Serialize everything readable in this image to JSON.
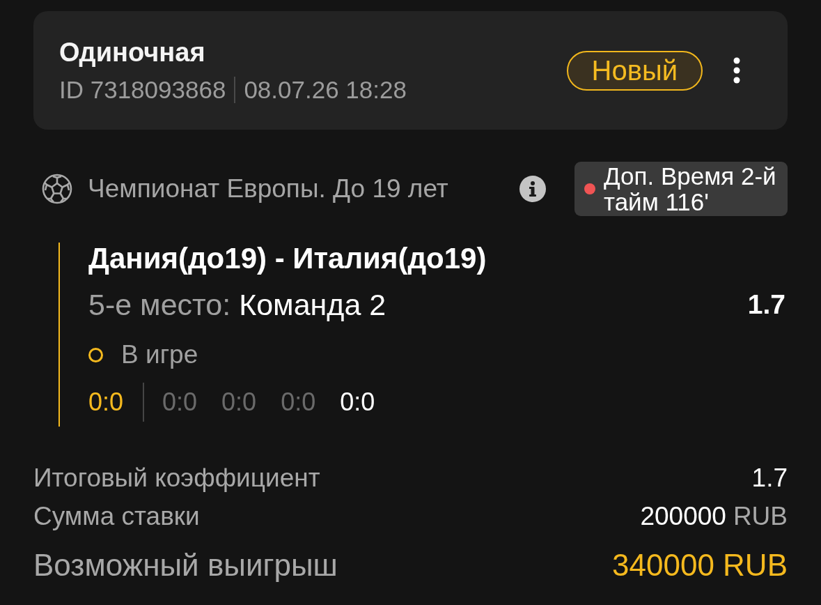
{
  "bet_card": {
    "type": "Одиночная",
    "id": "ID 7318093868",
    "datetime": "08.07.26 18:28",
    "status_badge": "Новый"
  },
  "event": {
    "league": "Чемпионат Европы. До 19 лет",
    "live_status": {
      "text": "Доп. Время 2-й тайм 116'",
      "live": true
    },
    "match": "Дания(до19) - Италия(до19)",
    "market_label": "5-е место:",
    "selection": "Команда 2",
    "odds": "1.7",
    "state": "В игре",
    "scores": [
      {
        "text": "0:0",
        "kind": "total"
      },
      {
        "text": "0:0",
        "kind": "period"
      },
      {
        "text": "0:0",
        "kind": "period"
      },
      {
        "text": "0:0",
        "kind": "period"
      },
      {
        "text": "0:0",
        "kind": "current"
      }
    ]
  },
  "summary": [
    {
      "label": "Итоговый коэффициент",
      "value": "1.7",
      "kind": "regular"
    },
    {
      "label": "Сумма ставки",
      "value": "200000",
      "currency": "RUB",
      "kind": "regular"
    },
    {
      "label": "Возможный выигрыш",
      "value": "340000 RUB",
      "kind": "highlight"
    }
  ]
}
